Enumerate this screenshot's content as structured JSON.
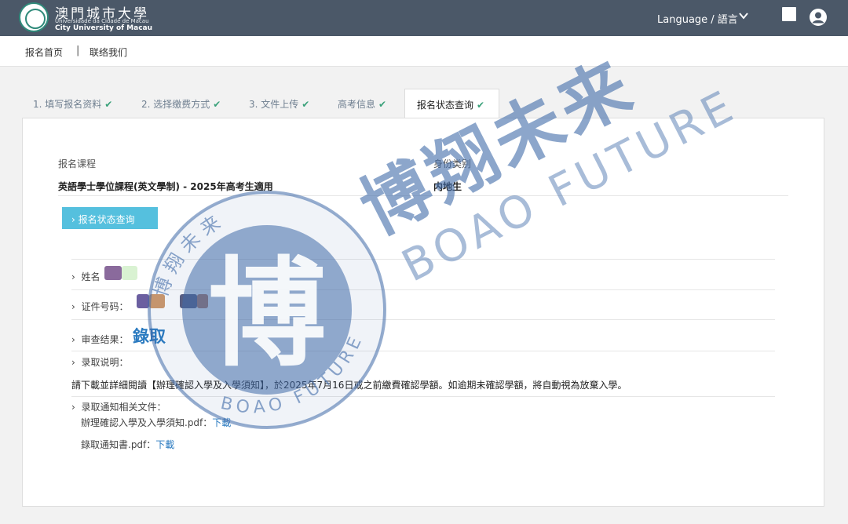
{
  "header": {
    "logo_cn": "澳門城市大學",
    "logo_pt": "Universidade da Cidade de Macau",
    "logo_en": "City University of Macau",
    "language_label": "Language / 語言"
  },
  "nav": {
    "home": "报名首页",
    "separator": "|",
    "contact": "联络我们"
  },
  "tabs": [
    {
      "label": "1. 填写报名资料",
      "done": "✔"
    },
    {
      "label": "2. 选择缴费方式",
      "done": "✔"
    },
    {
      "label": "3. 文件上传",
      "done": "✔"
    },
    {
      "label": "高考信息",
      "done": "✔"
    },
    {
      "label": "报名状态查询",
      "done": "✔"
    }
  ],
  "info": {
    "course_label": "报名课程",
    "course_value": "英語學士學位課程(英文學制) - 2025年高考生適用",
    "identity_label": "身份类别",
    "identity_value": "内地生"
  },
  "status_button": "›  报名状态查询",
  "rows": {
    "name_label": "姓名",
    "id_label": "证件号码：",
    "result_label": "审查结果：",
    "result_value": "錄取",
    "note_label": "录取说明：",
    "notice_text": "請下載並詳細閱讀【辦理確認入學及入學須知】，於2025年7月16日或之前繳費確認學額。如逾期未確認學額，將自動視為放棄入學。",
    "files_label": "录取通知相关文件：",
    "file1_name": "辦理確認入學及入學須知.pdf：",
    "file1_link": "下載",
    "file2_name": "錄取通知書.pdf：",
    "file2_link": "下載"
  },
  "watermark": {
    "cn": "博翔未来",
    "en": "BOAO FUTURE",
    "seal_cn": "博 翔 未 来",
    "seal_en": "BOAO FUTURE",
    "seal_center": "博"
  },
  "colors": {
    "header_bg": "#4b5868",
    "accent_button": "#55c0de",
    "check_green": "#3aa17a",
    "result_blue": "#2a7ac0",
    "watermark_blue": "#3f6aa8"
  }
}
